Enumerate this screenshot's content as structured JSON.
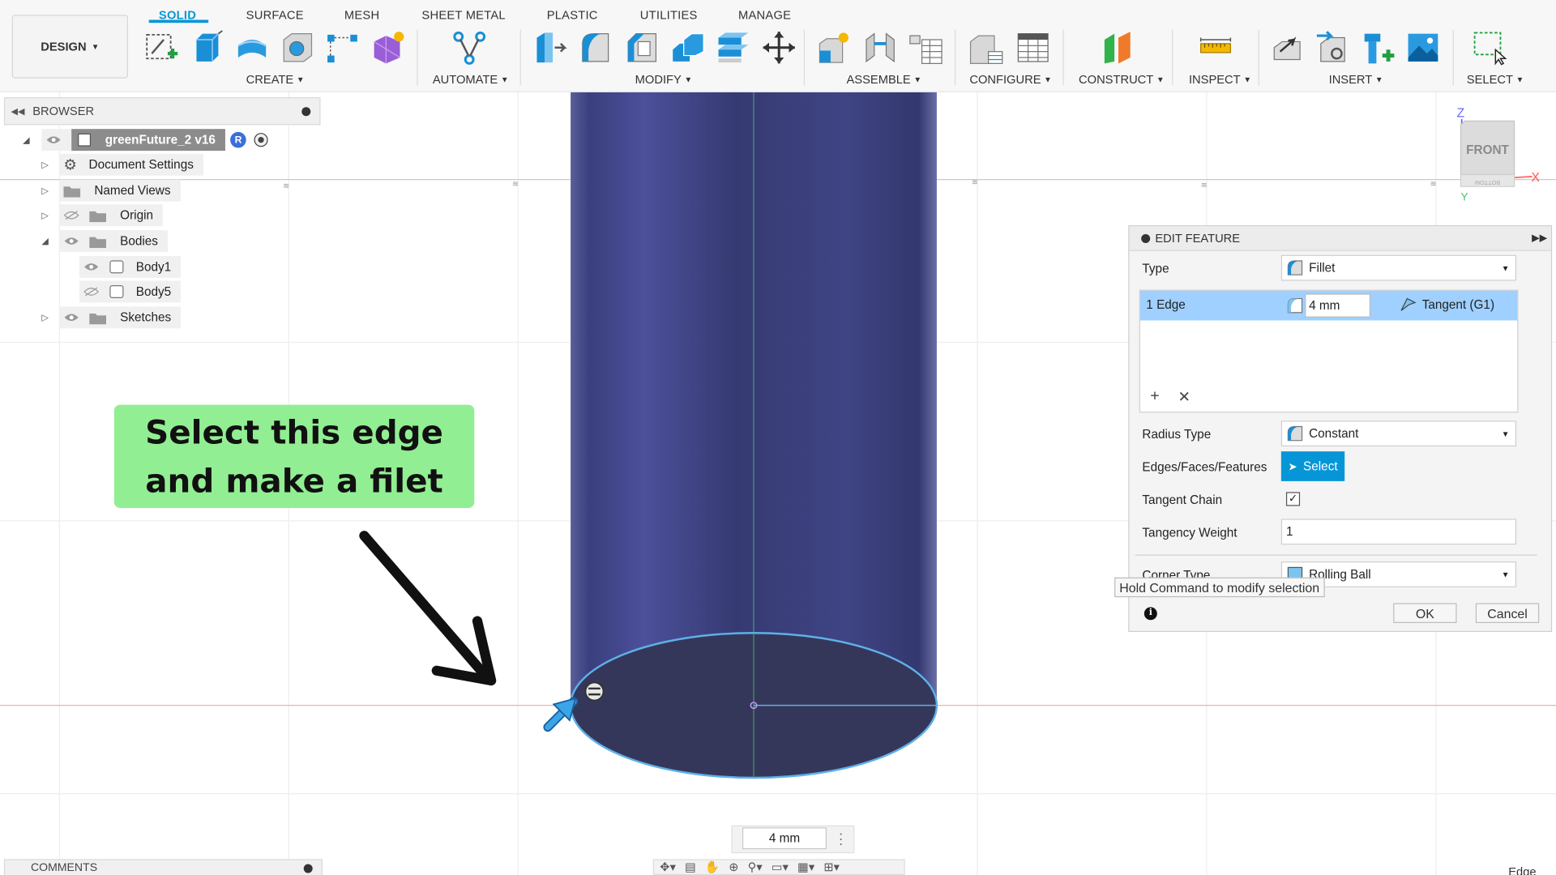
{
  "toolbar": {
    "design_label": "DESIGN",
    "tabs": [
      "SOLID",
      "SURFACE",
      "MESH",
      "SHEET METAL",
      "PLASTIC",
      "UTILITIES",
      "MANAGE"
    ],
    "active_tab": "SOLID",
    "groups": [
      "CREATE",
      "AUTOMATE",
      "MODIFY",
      "ASSEMBLE",
      "CONFIGURE",
      "CONSTRUCT",
      "INSPECT",
      "INSERT",
      "SELECT"
    ],
    "accent_color": "#0696d7"
  },
  "browser": {
    "title": "BROWSER",
    "document_name": "greenFuture_2 v16",
    "document_badge": "R",
    "items": [
      {
        "label": "Document Settings",
        "icon": "gear-icon"
      },
      {
        "label": "Named Views",
        "icon": "folder-icon"
      },
      {
        "label": "Origin",
        "icon": "folder-icon"
      },
      {
        "label": "Bodies",
        "icon": "folder-icon"
      },
      {
        "label": "Body1",
        "icon": "body-icon"
      },
      {
        "label": "Body5",
        "icon": "body-icon"
      },
      {
        "label": "Sketches",
        "icon": "folder-icon"
      }
    ]
  },
  "callout": {
    "line1": "Select this edge",
    "line2": "and make a filet",
    "color": "#92ee93"
  },
  "edit_feature": {
    "title": "EDIT FEATURE",
    "type_label": "Type",
    "type_value": "Fillet",
    "selection": {
      "edge": "1 Edge",
      "radius": "4 mm",
      "continuity": "Tangent (G1)"
    },
    "radius_type_label": "Radius Type",
    "radius_type_value": "Constant",
    "edges_label": "Edges/Faces/Features",
    "select_button": "Select",
    "tangent_chain_label": "Tangent Chain",
    "tangent_chain_checked": "✓",
    "tangency_weight_label": "Tangency Weight",
    "tangency_weight_value": "1",
    "corner_type_label": "Corner Type",
    "corner_type_value": "Rolling Ball",
    "ok": "OK",
    "cancel": "Cancel",
    "tooltip": "Hold Command to modify selection"
  },
  "viewcube": {
    "face": "FRONT",
    "bottom": "BOTTOM",
    "axis_z": "Z",
    "axis_x": "X",
    "axis_y": "Y"
  },
  "canvas": {
    "dimension_value": "4 mm",
    "body_color": "#3a3f78",
    "edge_highlight": "#5fb0e8"
  },
  "footer": {
    "comments": "COMMENTS",
    "corner_text": "Edge"
  }
}
